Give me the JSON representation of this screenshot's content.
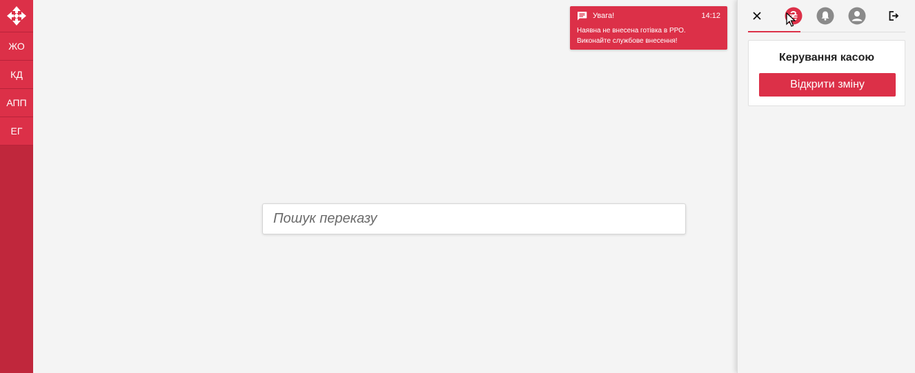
{
  "sidebar": {
    "logo_icon": "nova-poshta-logo-icon",
    "items": [
      {
        "label": "ЖО"
      },
      {
        "label": "КД"
      },
      {
        "label": "АПП"
      },
      {
        "label": "ЕГ"
      }
    ]
  },
  "search": {
    "placeholder": "Пошук переказу",
    "value": ""
  },
  "notification": {
    "icon": "chat-icon",
    "title": "Увага!",
    "time": "14:12",
    "line1": "Наявна не внесена готівка в РРО.",
    "line2": "Виконайте службове внесення!"
  },
  "panel": {
    "toolbar": {
      "close_icon": "close-icon",
      "cash_icon": "hryvnia-icon",
      "notifications_icon": "bell-icon",
      "profile_icon": "user-icon",
      "logout_icon": "logout-icon"
    },
    "card": {
      "title": "Керування касою",
      "button_label": "Відкрити зміну"
    }
  },
  "colors": {
    "brand_red": "#dc3048",
    "rail_dark": "#c0273c",
    "icon_gray": "#8a8a8a",
    "background": "#f4f4f4"
  }
}
